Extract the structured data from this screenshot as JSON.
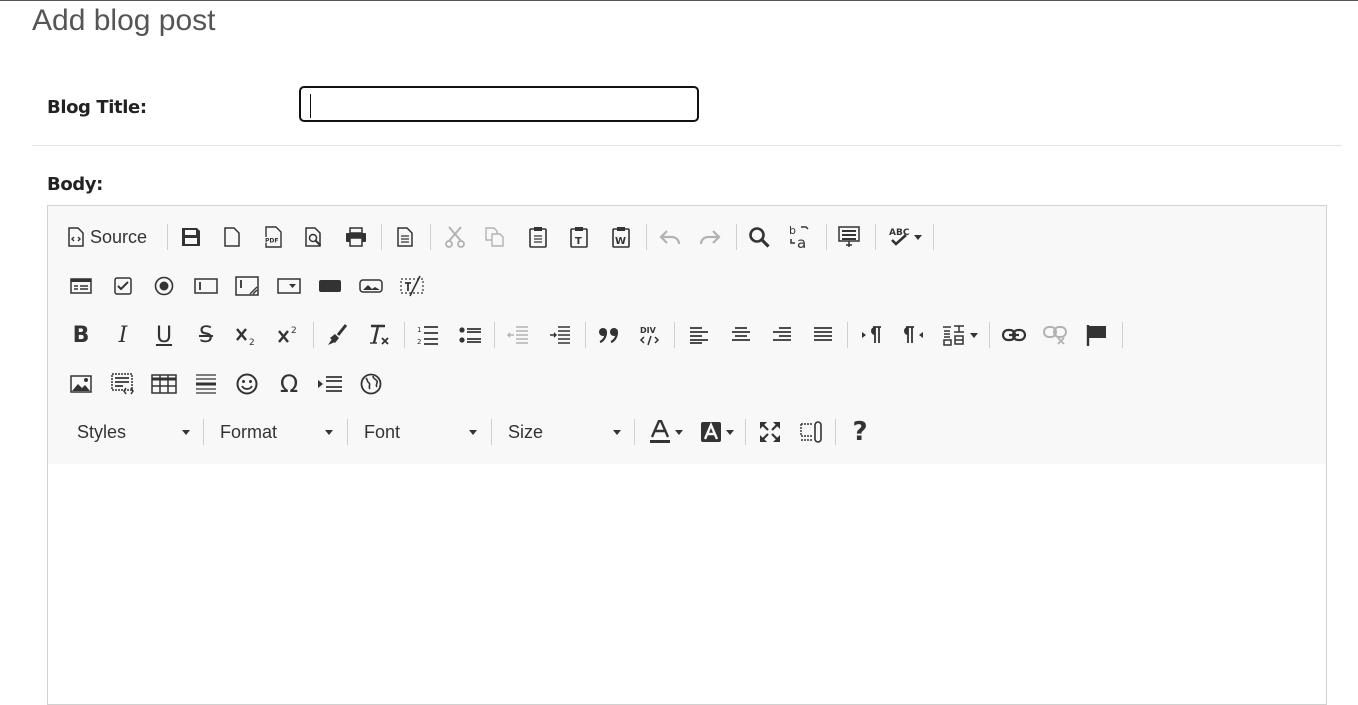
{
  "page": {
    "title": "Add blog post"
  },
  "form": {
    "blog_title_label": "Blog Title:",
    "blog_title_value": "",
    "body_label": "Body:"
  },
  "editor": {
    "source_label": "Source",
    "combos": {
      "styles": "Styles",
      "format": "Format",
      "font": "Font",
      "size": "Size"
    },
    "help_glyph": "?",
    "content": ""
  }
}
